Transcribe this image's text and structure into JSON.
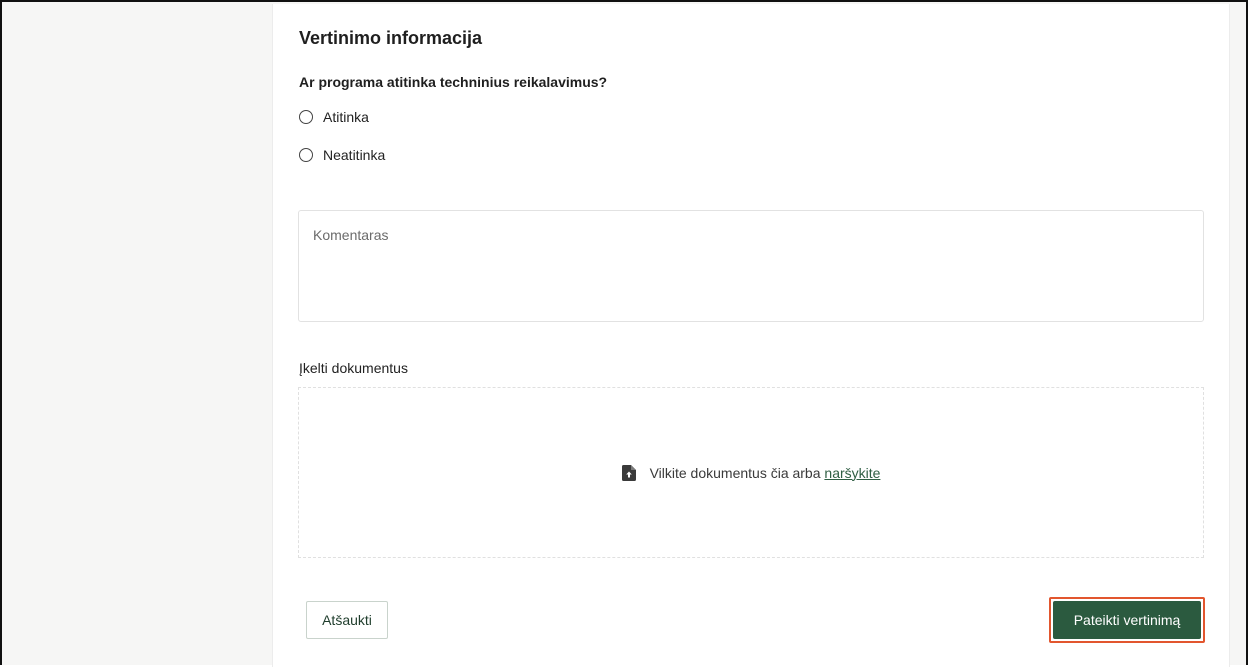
{
  "section": {
    "title": "Vertinimo informacija",
    "question": "Ar programa atitinka techninius reikalavimus?",
    "options": [
      {
        "label": "Atitinka",
        "selected": false
      },
      {
        "label": "Neatitinka",
        "selected": false
      }
    ]
  },
  "comment": {
    "placeholder": "Komentaras"
  },
  "upload": {
    "label": "Įkelti dokumentus",
    "prompt": "Vilkite dokumentus čia arba",
    "browse_link": "naršykite",
    "icon": "file-upload-icon"
  },
  "actions": {
    "cancel_label": "Atšaukti",
    "submit_label": "Pateikti vertinimą"
  },
  "colors": {
    "primary": "#2b5a3f",
    "highlight": "#e2562e",
    "link": "#2f5e43"
  }
}
